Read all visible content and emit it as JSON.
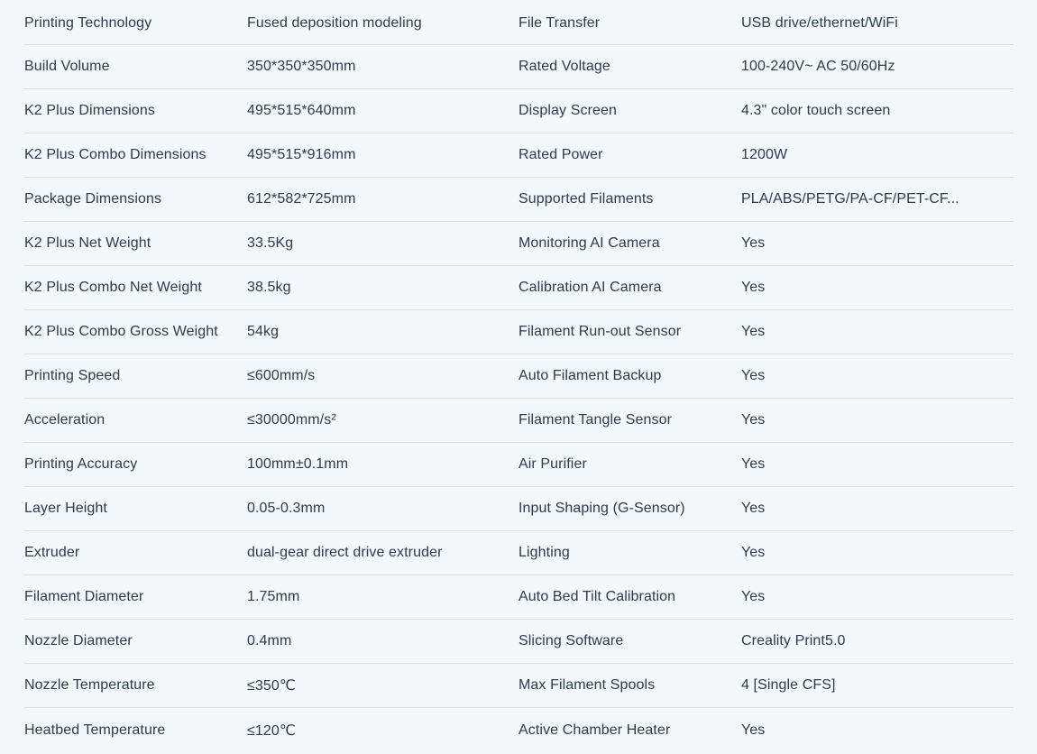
{
  "specs": [
    {
      "l1": "Printing Technology",
      "v1": "Fused deposition modeling",
      "l2": "File Transfer",
      "v2": "USB drive/ethernet/WiFi"
    },
    {
      "l1": "Build Volume",
      "v1": "350*350*350mm",
      "l2": "Rated Voltage",
      "v2": "100-240V~ AC 50/60Hz"
    },
    {
      "l1": "K2 Plus Dimensions",
      "v1": "495*515*640mm",
      "l2": "Display Screen",
      "v2": "4.3\" color touch screen"
    },
    {
      "l1": "K2 Plus Combo Dimensions",
      "v1": "495*515*916mm",
      "l2": "Rated Power",
      "v2": "1200W"
    },
    {
      "l1": "Package Dimensions",
      "v1": "612*582*725mm",
      "l2": "Supported Filaments",
      "v2": "PLA/ABS/PETG/PA-CF/PET-CF..."
    },
    {
      "l1": "K2 Plus Net Weight",
      "v1": "33.5Kg",
      "l2": "Monitoring AI Camera",
      "v2": "Yes"
    },
    {
      "l1": "K2 Plus Combo Net Weight",
      "v1": "38.5kg",
      "l2": "Calibration AI Camera",
      "v2": "Yes"
    },
    {
      "l1": "K2 Plus Combo Gross Weight",
      "v1": "54kg",
      "l2": "Filament Run-out Sensor",
      "v2": "Yes"
    },
    {
      "l1": "Printing Speed",
      "v1": "≤600mm/s",
      "l2": "Auto Filament Backup",
      "v2": "Yes"
    },
    {
      "l1": "Acceleration",
      "v1": "≤30000mm/s²",
      "l2": "Filament Tangle Sensor",
      "v2": "Yes"
    },
    {
      "l1": "Printing Accuracy",
      "v1": "100mm±0.1mm",
      "l2": "Air Purifier",
      "v2": "Yes"
    },
    {
      "l1": "Layer Height",
      "v1": "0.05-0.3mm",
      "l2": "Input Shaping (G-Sensor)",
      "v2": "Yes"
    },
    {
      "l1": "Extruder",
      "v1": "dual-gear direct drive extruder",
      "l2": "Lighting",
      "v2": "Yes"
    },
    {
      "l1": "Filament Diameter",
      "v1": "1.75mm",
      "l2": "Auto Bed Tilt Calibration",
      "v2": "Yes"
    },
    {
      "l1": "Nozzle Diameter",
      "v1": "0.4mm",
      "l2": "Slicing Software",
      "v2": "Creality Print5.0"
    },
    {
      "l1": "Nozzle Temperature",
      "v1": "≤350℃",
      "l2": "Max Filament Spools",
      "v2": "4 [Single CFS]"
    },
    {
      "l1": "Heatbed Temperature",
      "v1": "≤120℃",
      "l2": "Active Chamber Heater",
      "v2": "Yes"
    }
  ]
}
